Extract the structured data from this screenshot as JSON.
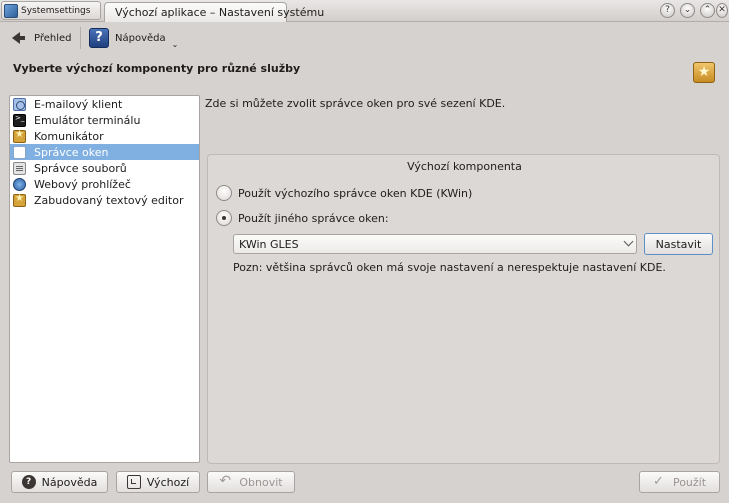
{
  "window": {
    "app_button_label": "Systemsettings",
    "tab_title": "Výchozí aplikace – Nastavení systému",
    "help_btn": "?",
    "min_btn": "⌄",
    "max_btn": "⌃",
    "close_btn": "✕"
  },
  "toolbar": {
    "back_label": "Přehled",
    "help_label": "Nápověda",
    "help_icon": "?"
  },
  "header": {
    "title": "Vyberte výchozí komponenty pro různé služby"
  },
  "sidebar": {
    "items": [
      {
        "label": "E-mailový klient",
        "icon": "mail-icon"
      },
      {
        "label": "Emulátor terminálu",
        "icon": "terminal-icon"
      },
      {
        "label": "Komunikátor",
        "icon": "star-icon"
      },
      {
        "label": "Správce oken",
        "icon": "window-icon",
        "selected": true
      },
      {
        "label": "Správce souborů",
        "icon": "files-icon"
      },
      {
        "label": "Webový prohlížeč",
        "icon": "web-icon"
      },
      {
        "label": "Zabudovaný textový editor",
        "icon": "editor-icon"
      }
    ]
  },
  "main": {
    "description": "Zde si můžete zvolit správce oken pro své sezení KDE.",
    "group_title": "Výchozí komponenta",
    "radio_default": "Použít výchozího správce oken KDE (KWin)",
    "radio_other": "Použít jiného správce oken:",
    "selected_wm": "KWin GLES",
    "configure_button": "Nastavit",
    "note": "Pozn: většina správců oken má svoje nastavení a nerespektuje nastavení KDE."
  },
  "footer": {
    "help_button": "Nápověda",
    "defaults_button": "Výchozí",
    "reset_button": "Obnovit",
    "apply_button": "Použít"
  },
  "colors": {
    "selection": "#80b0e1",
    "window_bg": "#d6d2d0"
  }
}
